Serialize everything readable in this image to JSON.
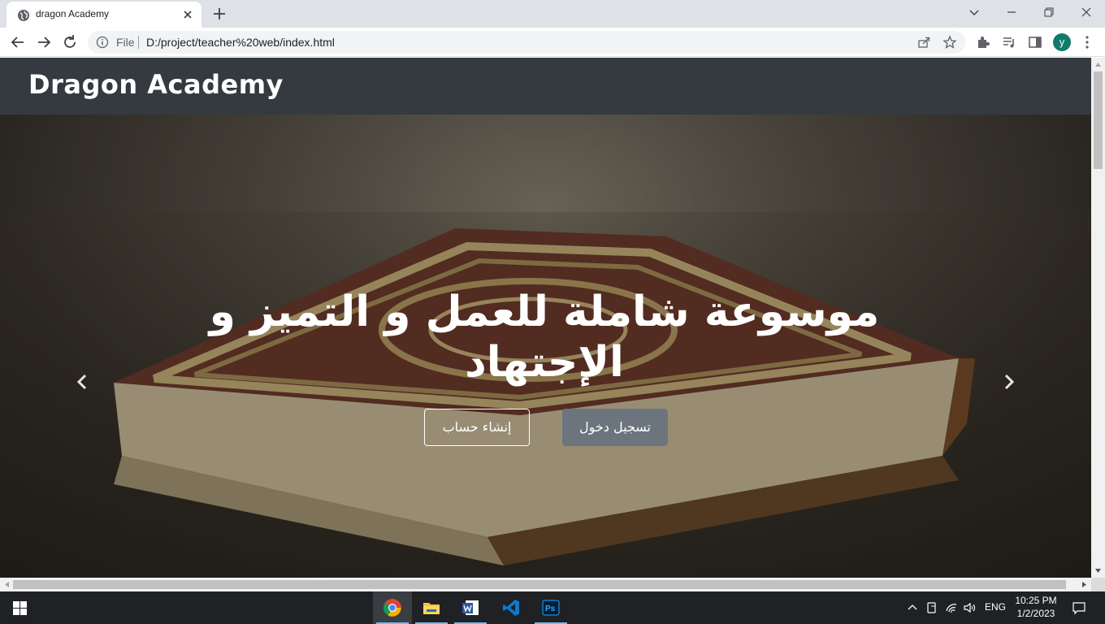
{
  "browser": {
    "tab_title": "dragon Academy",
    "address_scheme_label": "File",
    "address_url": "D:/project/teacher%20web/index.html",
    "profile_initial": "y"
  },
  "site": {
    "brand": "Dragon Academy",
    "hero_title": "موسوعة شاملة للعمل و التميز و الإجتهاد",
    "buttons": {
      "register": "إنشاء حساب",
      "login": "تسجيل دخول"
    }
  },
  "taskbar": {
    "apps": [
      "chrome",
      "file-explorer",
      "word",
      "vscode",
      "photoshop"
    ],
    "language": "ENG",
    "time": "10:25 PM",
    "date": "1/2/2023"
  },
  "colors": {
    "navbar_bg": "#343a40",
    "login_button_bg": "#6c757d",
    "taskbar_bg": "#1f2125"
  }
}
